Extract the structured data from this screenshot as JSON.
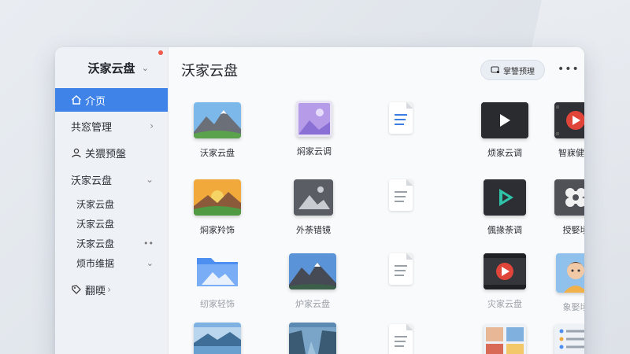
{
  "sidebar": {
    "brand": "沃家云盘",
    "brand_chevron": "⌄",
    "active_item": "介页",
    "items": [
      {
        "label": "共窓管理",
        "chevron": "›"
      },
      {
        "label": "关猥预盤",
        "chevron": ""
      },
      {
        "label": "沃家云盘",
        "chevron": "⌄"
      }
    ],
    "sub_items": [
      {
        "label": "沃家云盘",
        "chevron": ""
      },
      {
        "label": "沃家云盘",
        "chevron": ""
      },
      {
        "label": "沃家云盘",
        "chevron": "••"
      },
      {
        "label": "烦市维据",
        "chevron": "⌄"
      }
    ],
    "bottom_item": {
      "label": "翻㬉",
      "chevron": "›"
    }
  },
  "main": {
    "title": "沃家云盘",
    "top_button": "掌讐预理",
    "more": "•••",
    "tiles": [
      {
        "label": "沃家云盘",
        "type": "image-mountain"
      },
      {
        "label": "焖家云调",
        "type": "image-purple"
      },
      {
        "label": "",
        "type": "doc-blue"
      },
      {
        "label": "烦家云调",
        "type": "video-dark"
      },
      {
        "label": "智寐健盘",
        "type": "video-red"
      },
      {
        "label": "焖家羚饰",
        "type": "image-sunset"
      },
      {
        "label": "外荼错镜",
        "type": "image-gray"
      },
      {
        "label": "",
        "type": "doc-gray"
      },
      {
        "label": "偑掾荼调",
        "type": "video-teal"
      },
      {
        "label": "授婜顷",
        "type": "image-bloom"
      },
      {
        "label": "纫家轻饰",
        "type": "folder-blue"
      },
      {
        "label": "炉家云盘",
        "type": "folder-mountain"
      },
      {
        "label": "",
        "type": "doc-gray"
      },
      {
        "label": "灾家云盘",
        "type": "video-film"
      },
      {
        "label": "象娶顷",
        "type": "image-child"
      },
      {
        "label": "",
        "type": "folder-lake"
      },
      {
        "label": "",
        "type": "folder-canyon"
      },
      {
        "label": "",
        "type": "doc-gray"
      },
      {
        "label": "",
        "type": "image-collage"
      },
      {
        "label": "",
        "type": "list-card"
      }
    ]
  }
}
